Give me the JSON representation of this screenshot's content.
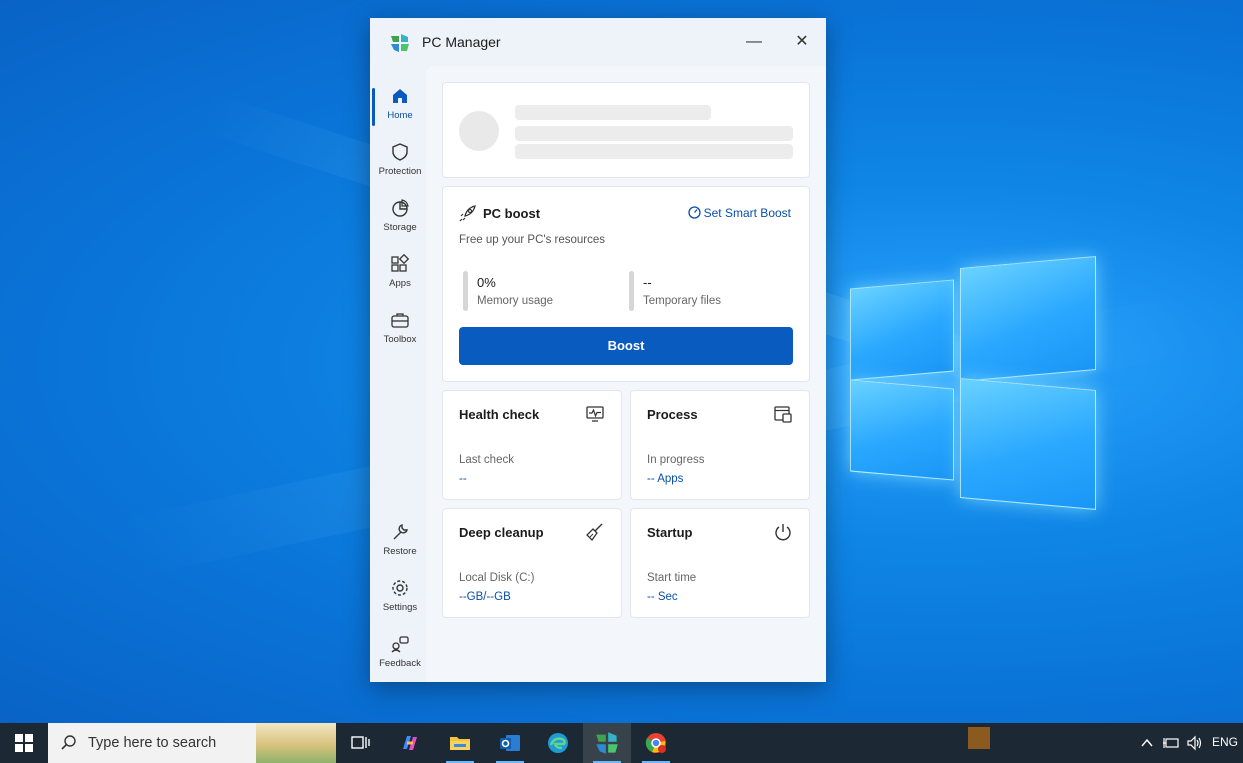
{
  "window": {
    "title": "PC Manager",
    "minimize_glyph": "—",
    "close_glyph": "✕"
  },
  "sidebar": {
    "items": [
      {
        "label": "Home",
        "icon": "home-icon",
        "active": true
      },
      {
        "label": "Protection",
        "icon": "shield-icon"
      },
      {
        "label": "Storage",
        "icon": "pie-chart-icon"
      },
      {
        "label": "Apps",
        "icon": "apps-icon"
      },
      {
        "label": "Toolbox",
        "icon": "toolbox-icon"
      }
    ],
    "bottom_items": [
      {
        "label": "Restore",
        "icon": "wrench-icon"
      },
      {
        "label": "Settings",
        "icon": "gear-icon"
      },
      {
        "label": "Feedback",
        "icon": "feedback-icon"
      }
    ]
  },
  "boost": {
    "title": "PC boost",
    "smart_link": "Set Smart Boost",
    "subtitle": "Free up your PC's resources",
    "memory_value": "0%",
    "memory_label": "Memory usage",
    "temp_value": "--",
    "temp_label": "Temporary files",
    "button": "Boost"
  },
  "tiles": {
    "health": {
      "title": "Health check",
      "sub": "Last check",
      "value": "--"
    },
    "process": {
      "title": "Process",
      "sub": "In progress",
      "value": "-- Apps"
    },
    "cleanup": {
      "title": "Deep cleanup",
      "sub": "Local Disk (C:)",
      "value": "--GB/--GB"
    },
    "startup": {
      "title": "Startup",
      "sub": "Start time",
      "value": "-- Sec"
    }
  },
  "taskbar": {
    "search_placeholder": "Type here to search",
    "language": "ENG"
  },
  "colors": {
    "accent": "#0a5bbf",
    "link": "#0a4fa6",
    "taskbar": "#1c2833"
  }
}
